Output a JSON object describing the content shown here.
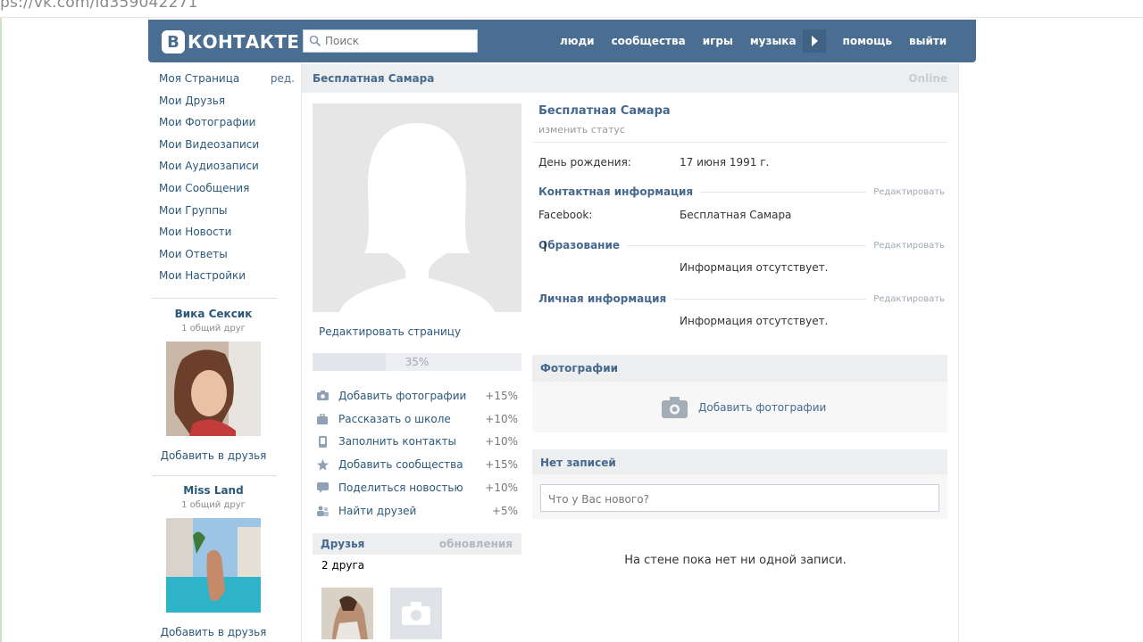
{
  "browser": {
    "url": "ps://vk.com/id359042271"
  },
  "header": {
    "logo_mark": "В",
    "logo_text": "КОНТАКТЕ",
    "search_placeholder": "Поиск",
    "nav": [
      "люди",
      "сообщества",
      "игры",
      "музыка",
      "помощь",
      "выйти"
    ],
    "bg_color": "#4a6e92"
  },
  "sidebar": {
    "items": [
      {
        "label": "Моя Страница",
        "extra": "ред."
      },
      {
        "label": "Мои Друзья"
      },
      {
        "label": "Мои Фотографии"
      },
      {
        "label": "Мои Видеозаписи"
      },
      {
        "label": "Мои Аудиозаписи"
      },
      {
        "label": "Мои Сообщения"
      },
      {
        "label": "Мои Группы"
      },
      {
        "label": "Мои Новости"
      },
      {
        "label": "Мои Ответы"
      },
      {
        "label": "Мои Настройки"
      }
    ],
    "suggestions": [
      {
        "name": "Вика Сексик",
        "common": "1 общий друг",
        "add": "Добавить в друзья"
      },
      {
        "name": "Miss Land",
        "common": "1 общий друг",
        "add": "Добавить в друзья"
      }
    ]
  },
  "profile": {
    "name": "Бесплатная Самара",
    "online": "Online",
    "status_link": "изменить статус",
    "edit_page": "Редактировать страницу",
    "completion": {
      "value": 0.35,
      "label": "35%"
    },
    "tasks": [
      {
        "icon": "camera-icon",
        "label": "Добавить фотографии",
        "points": "+15%"
      },
      {
        "icon": "briefcase-icon",
        "label": "Рассказать о школе",
        "points": "+10%"
      },
      {
        "icon": "phone-icon",
        "label": "Заполнить контакты",
        "points": "+10%"
      },
      {
        "icon": "star-icon",
        "label": "Добавить сообщества",
        "points": "+15%"
      },
      {
        "icon": "comment-icon",
        "label": "Поделиться новостью",
        "points": "+10%"
      },
      {
        "icon": "people-icon",
        "label": "Найти друзей",
        "points": "+5%"
      }
    ],
    "friends": {
      "title": "Друзья",
      "updates": "обновления",
      "count": "2 друга"
    }
  },
  "info": {
    "birthday_key": "День рождения:",
    "birthday_val": "17 июня 1991 г.",
    "contact_title": "Контактная информация",
    "edit": "Редактировать",
    "facebook_key": "Facebook:",
    "facebook_val": "Бесплатная Самара",
    "education_title": "Образование",
    "no_info": "Информация отсутствует.",
    "personal_title": "Личная информация"
  },
  "photos": {
    "title": "Фотографии",
    "add": "Добавить фотографии"
  },
  "wall": {
    "title": "Нет записей",
    "placeholder": "Что у Вас нового?",
    "empty": "На стене пока нет ни одной записи."
  }
}
